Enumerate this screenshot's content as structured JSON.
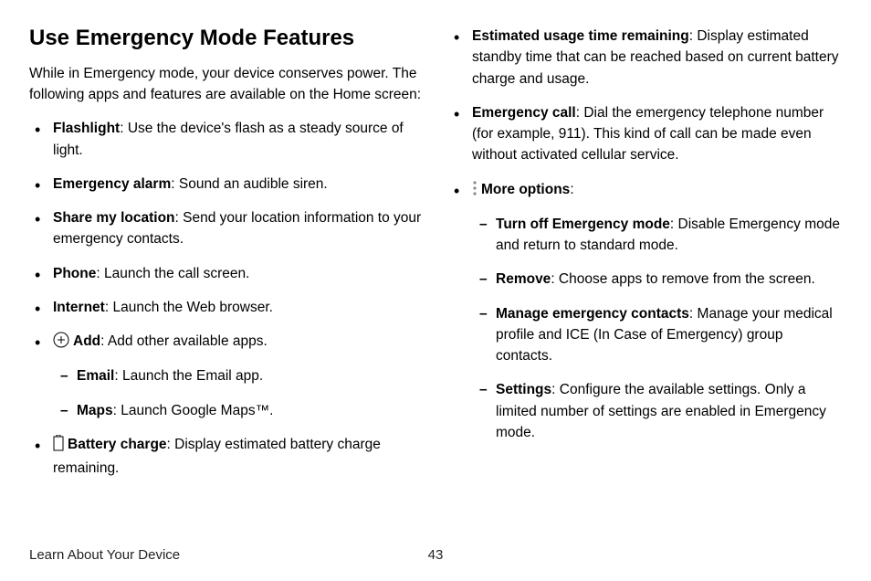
{
  "title": "Use Emergency Mode Features",
  "intro": "While in Emergency mode, your device conserves power. The following apps and features are available on the Home screen:",
  "left": {
    "flashlight": {
      "label": "Flashlight",
      "desc": ": Use the device's flash as a steady source of light."
    },
    "alarm": {
      "label": "Emergency alarm",
      "desc": ": Sound an audible siren."
    },
    "share": {
      "label": "Share my location",
      "desc": ": Send your location information to your emergency contacts."
    },
    "phone": {
      "label": "Phone",
      "desc": ": Launch the call screen."
    },
    "internet": {
      "label": "Internet",
      "desc": ": Launch the Web browser."
    },
    "add": {
      "label": "Add",
      "desc": ": Add other available apps."
    },
    "email": {
      "label": "Email",
      "desc": ": Launch the Email app."
    },
    "maps": {
      "label": "Maps",
      "desc": ": Launch Google Maps™."
    },
    "battery": {
      "label": "Battery charge",
      "desc": ": Display estimated battery charge remaining."
    }
  },
  "right": {
    "estimated": {
      "label": "Estimated usage time remaining",
      "desc": ": Display estimated standby time that can be reached based on current battery charge and usage."
    },
    "call": {
      "label": "Emergency call",
      "desc": ": Dial the emergency telephone number (for example, 911). This kind of call can be made even without activated cellular service."
    },
    "more": {
      "label": "More options",
      "desc": ":"
    },
    "turnoff": {
      "label": "Turn off Emergency mode",
      "desc": ": Disable Emergency mode and return to standard mode."
    },
    "remove": {
      "label": "Remove",
      "desc": ": Choose apps to remove from the screen."
    },
    "manage": {
      "label": "Manage emergency contacts",
      "desc": ": Manage your medical profile and ICE (In Case of Emergency) group contacts."
    },
    "settings": {
      "label": "Settings",
      "desc": ": Configure the available settings. Only a limited number of settings are enabled in Emergency mode."
    }
  },
  "footer": {
    "breadcrumb": "Learn About Your Device",
    "page": "43"
  }
}
